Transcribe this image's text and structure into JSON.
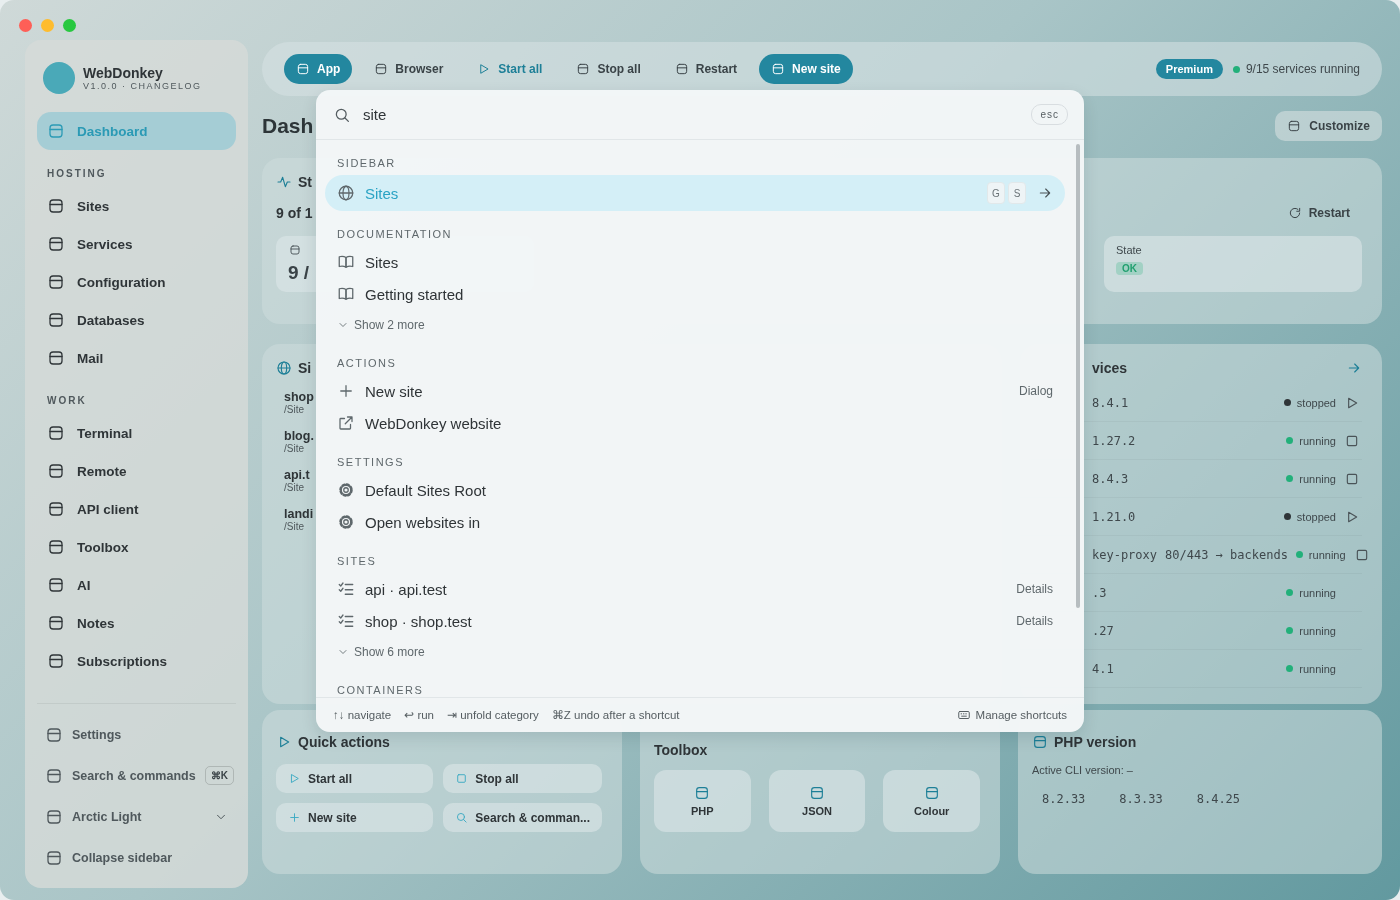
{
  "app": {
    "sidebar": {
      "brand": "WebDonkey",
      "version": "V1.0.0 · CHANGELOG",
      "items": [
        {
          "kind": "item",
          "label": "Dashboard",
          "selected": true
        },
        {
          "kind": "heading",
          "label": "HOSTING"
        },
        {
          "kind": "item",
          "label": "Sites",
          "selected": false
        },
        {
          "kind": "item",
          "label": "Services",
          "selected": false
        },
        {
          "kind": "item",
          "label": "Configuration",
          "selected": false
        },
        {
          "kind": "item",
          "label": "Databases",
          "selected": false
        },
        {
          "kind": "item",
          "label": "Mail",
          "selected": false
        },
        {
          "kind": "heading",
          "label": "WORK"
        },
        {
          "kind": "item",
          "label": "Terminal",
          "selected": false
        },
        {
          "kind": "item",
          "label": "Remote",
          "selected": false
        },
        {
          "kind": "item",
          "label": "API client",
          "selected": false
        },
        {
          "kind": "item",
          "label": "Toolbox",
          "selected": false
        },
        {
          "kind": "item",
          "label": "AI",
          "selected": false
        },
        {
          "kind": "item",
          "label": "Notes",
          "selected": false
        },
        {
          "kind": "item",
          "label": "Subscriptions",
          "selected": false
        }
      ],
      "footer": [
        {
          "kind": "item",
          "label": "Settings"
        },
        {
          "kind": "shortcut",
          "label": "Search & commands",
          "key": "⌘K"
        },
        {
          "kind": "dropdown",
          "label": "Arctic Light"
        },
        {
          "kind": "item",
          "label": "Collapse sidebar"
        }
      ]
    },
    "toolbar": {
      "buttons": [
        {
          "kind": "primary",
          "label": "App"
        },
        {
          "kind": "plain",
          "label": "Browser"
        },
        {
          "kind": "accent",
          "label": "Start all"
        },
        {
          "kind": "plain",
          "label": "Stop all"
        },
        {
          "kind": "plain",
          "label": "Restart"
        },
        {
          "kind": "primary",
          "label": "New site"
        }
      ],
      "badge": "Premium",
      "status": "9/15 services running"
    },
    "heading": "Dash",
    "customize": "Customize",
    "status_card": {
      "title": "St",
      "summary": "9 of 1",
      "restart": "Restart",
      "tile_value": "9 /",
      "state_label": "State",
      "state_value": "OK"
    },
    "sites_card": {
      "title": "Si",
      "rows": [
        {
          "name": "shop",
          "path": "/Site"
        },
        {
          "name": "blog.",
          "path": "/Site"
        },
        {
          "name": "api.t",
          "path": "/Site"
        },
        {
          "name": "landi",
          "path": "/Site"
        }
      ]
    },
    "services_card": {
      "title": "vices",
      "rows": [
        {
          "name": "8.4.1",
          "status": "stopped",
          "running": false,
          "control": true
        },
        {
          "name": "1.27.2",
          "status": "running",
          "running": true,
          "control": true
        },
        {
          "name": "8.4.3",
          "status": "running",
          "running": true,
          "control": true
        },
        {
          "name": "1.21.0",
          "status": "stopped",
          "running": false,
          "control": true
        },
        {
          "name": "key-proxy",
          "detail": "80/443 → backends",
          "status": "running",
          "running": true,
          "control": true
        },
        {
          "name": ".3",
          "status": "running",
          "running": true,
          "control": false
        },
        {
          "name": ".27",
          "status": "running",
          "running": true,
          "control": false
        },
        {
          "name": "4.1",
          "status": "running",
          "running": true,
          "control": false
        }
      ]
    },
    "quick_actions": {
      "title": "Quick actions",
      "buttons": [
        "Start all",
        "Stop all",
        "New site",
        "Search & comman..."
      ]
    },
    "toolbox": {
      "title": "Toolbox",
      "tiles": [
        "PHP",
        "JSON",
        "Colour"
      ]
    },
    "php_version": {
      "title": "PHP version",
      "subtitle": "Active CLI version: –",
      "versions": [
        "8.2.33",
        "8.3.33",
        "8.4.25"
      ]
    }
  },
  "palette": {
    "query": "site",
    "close_key": "esc",
    "sections": [
      {
        "title": "SIDEBAR",
        "items": [
          {
            "kind": "item",
            "label": "Sites",
            "selected": true,
            "keys": [
              "G",
              "S"
            ]
          }
        ]
      },
      {
        "title": "DOCUMENTATION",
        "items": [
          {
            "kind": "item",
            "label": "Sites",
            "selected": false
          },
          {
            "kind": "item",
            "label": "Getting started",
            "selected": false
          },
          {
            "kind": "more",
            "label": "Show 2 more"
          }
        ]
      },
      {
        "title": "ACTIONS",
        "items": [
          {
            "kind": "item",
            "label": "New site",
            "selected": false,
            "hint": "Dialog"
          },
          {
            "kind": "item",
            "label": "WebDonkey website",
            "selected": false
          }
        ]
      },
      {
        "title": "SETTINGS",
        "items": [
          {
            "kind": "item",
            "label": "Default Sites Root",
            "selected": false
          },
          {
            "kind": "item",
            "label": "Open websites in",
            "selected": false
          }
        ]
      },
      {
        "title": "SITES",
        "items": [
          {
            "kind": "item",
            "label": "api · api.test",
            "selected": false,
            "hint": "Details"
          },
          {
            "kind": "item",
            "label": "shop · shop.test",
            "selected": false,
            "hint": "Details"
          },
          {
            "kind": "more",
            "label": "Show 6 more"
          }
        ]
      },
      {
        "title": "CONTAINERS"
      }
    ],
    "footer": {
      "hints": [
        {
          "key": "↑↓",
          "label": "navigate"
        },
        {
          "key": "↩",
          "label": "run"
        },
        {
          "key": "⇥",
          "label": "unfold category"
        },
        {
          "key": "⌘Z",
          "label": "undo after a shortcut"
        }
      ],
      "manage": "Manage shortcuts"
    }
  }
}
